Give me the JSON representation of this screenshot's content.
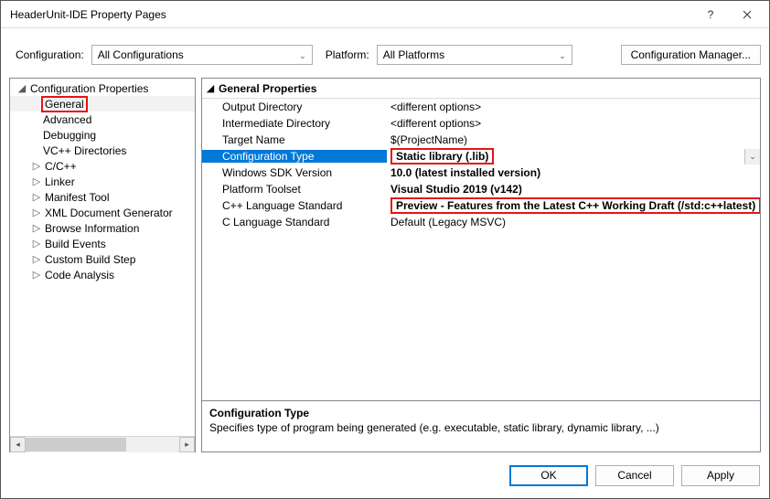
{
  "window": {
    "title": "HeaderUnit-IDE Property Pages"
  },
  "topbar": {
    "configuration_label": "Configuration:",
    "configuration_value": "All Configurations",
    "platform_label": "Platform:",
    "platform_value": "All Platforms",
    "manager_button": "Configuration Manager..."
  },
  "tree": {
    "root": "Configuration Properties",
    "items": [
      {
        "label": "General",
        "expandable": false,
        "highlighted": true,
        "selected": true
      },
      {
        "label": "Advanced",
        "expandable": false
      },
      {
        "label": "Debugging",
        "expandable": false
      },
      {
        "label": "VC++ Directories",
        "expandable": false
      },
      {
        "label": "C/C++",
        "expandable": true
      },
      {
        "label": "Linker",
        "expandable": true
      },
      {
        "label": "Manifest Tool",
        "expandable": true
      },
      {
        "label": "XML Document Generator",
        "expandable": true
      },
      {
        "label": "Browse Information",
        "expandable": true
      },
      {
        "label": "Build Events",
        "expandable": true
      },
      {
        "label": "Custom Build Step",
        "expandable": true
      },
      {
        "label": "Code Analysis",
        "expandable": true
      }
    ]
  },
  "grid": {
    "header": "General Properties",
    "rows": [
      {
        "key": "Output Directory",
        "value": "<different options>",
        "bold": false
      },
      {
        "key": "Intermediate Directory",
        "value": "<different options>",
        "bold": false
      },
      {
        "key": "Target Name",
        "value": "$(ProjectName)",
        "bold": false
      },
      {
        "key": "Configuration Type",
        "value": "Static library (.lib)",
        "bold": true,
        "selected": true,
        "highlight_value": true,
        "dropdown": true
      },
      {
        "key": "Windows SDK Version",
        "value": "10.0 (latest installed version)",
        "bold": true
      },
      {
        "key": "Platform Toolset",
        "value": "Visual Studio 2019 (v142)",
        "bold": true
      },
      {
        "key": "C++ Language Standard",
        "value": "Preview - Features from the Latest C++ Working Draft (/std:c++latest)",
        "bold": true,
        "highlight_value": true
      },
      {
        "key": "C Language Standard",
        "value": "Default (Legacy MSVC)",
        "bold": false
      }
    ]
  },
  "description": {
    "title": "Configuration Type",
    "text": "Specifies type of program being generated (e.g. executable, static library, dynamic library, ...)"
  },
  "footer": {
    "ok": "OK",
    "cancel": "Cancel",
    "apply": "Apply"
  }
}
